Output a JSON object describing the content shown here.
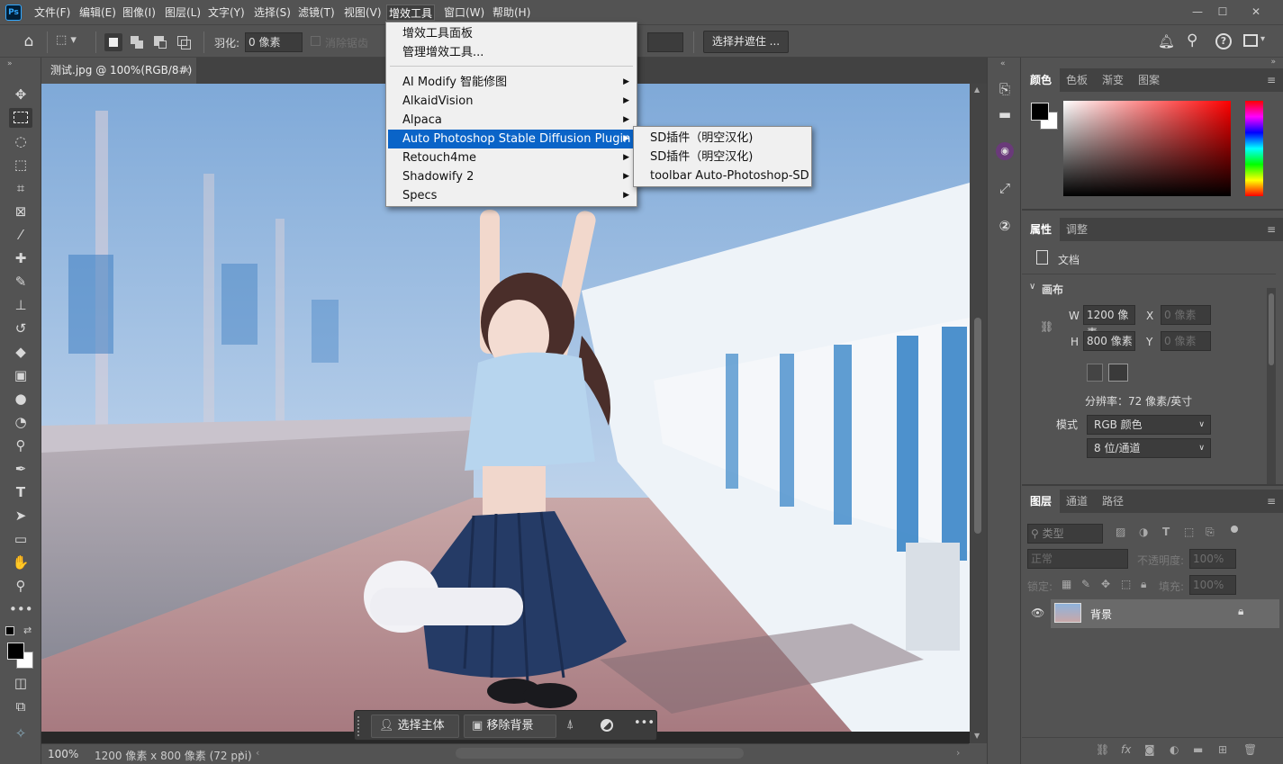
{
  "app": {
    "logo": "Ps"
  },
  "menubar": {
    "items": [
      "文件(F)",
      "编辑(E)",
      "图像(I)",
      "图层(L)",
      "文字(Y)",
      "选择(S)",
      "滤镜(T)",
      "视图(V)",
      "增效工具",
      "窗口(W)",
      "帮助(H)"
    ],
    "window_controls": [
      "minimize-icon",
      "restore-icon",
      "close-icon"
    ]
  },
  "options": {
    "feather_label": "羽化:",
    "feather_value": "0 像素",
    "antialias_label": "消除锯齿",
    "select_mask_label": "选择并遮住 ..."
  },
  "document": {
    "tab_title": "测试.jpg @ 100%(RGB/8#)",
    "tab_close": "×",
    "zoom": "100%",
    "size_info": "1200 像素 x 800 像素 (72 ppi)",
    "status_arrow": "›"
  },
  "plugins_menu": {
    "items": [
      {
        "label": "增效工具面板",
        "submenu": false,
        "highlight": false
      },
      {
        "label": "管理增效工具...",
        "submenu": false,
        "highlight": false
      },
      {
        "label": "AI Modify 智能修图",
        "submenu": true,
        "highlight": false
      },
      {
        "label": "AlkaidVision",
        "submenu": true,
        "highlight": false
      },
      {
        "label": "Alpaca",
        "submenu": true,
        "highlight": false
      },
      {
        "label": "Auto Photoshop Stable Diffusion Plugin",
        "submenu": true,
        "highlight": true
      },
      {
        "label": "Retouch4me",
        "submenu": true,
        "highlight": false
      },
      {
        "label": "Shadowify 2",
        "submenu": true,
        "highlight": false
      },
      {
        "label": "Specs",
        "submenu": true,
        "highlight": false
      }
    ],
    "arrow_glyph": "▶"
  },
  "submenu": {
    "items": [
      "SD插件（明空汉化)",
      "SD插件（明空汉化)",
      "toolbar Auto-Photoshop-SD"
    ]
  },
  "color_panel": {
    "tabs": [
      "颜色",
      "色板",
      "渐变",
      "图案"
    ],
    "active": "颜色",
    "foreground": "#000000",
    "background": "#ffffff",
    "picker_hue": "#ff0000"
  },
  "properties_panel": {
    "tabs": [
      "属性",
      "调整"
    ],
    "active": "属性",
    "doc_label": "文档",
    "canvas_section": "画布",
    "w_label": "W",
    "w_value": "1200 像素",
    "h_label": "H",
    "h_value": "800 像素",
    "x_label": "X",
    "x_value": "0 像素",
    "y_label": "Y",
    "y_value": "0 像素",
    "resolution": "分辨率：72 像素/英寸",
    "mode_label": "模式",
    "mode_value": "RGB 颜色",
    "depth_value": "8 位/通道"
  },
  "layers_panel": {
    "tabs": [
      "图层",
      "通道",
      "路径"
    ],
    "active": "图层",
    "filter_placeholder": "类型",
    "blend_mode": "正常",
    "opacity_label": "不透明度:",
    "opacity_value": "100%",
    "lock_label": "锁定:",
    "fill_label": "填充:",
    "fill_value": "100%",
    "layers": [
      {
        "name": "背景",
        "visible": true,
        "locked": true
      }
    ]
  },
  "context_bar": {
    "select_subject": "选择主体",
    "remove_background": "移除背景",
    "more": "•••"
  },
  "colors": {
    "accent": "#0a64c8",
    "panel": "#535353",
    "dark": "#424242"
  }
}
